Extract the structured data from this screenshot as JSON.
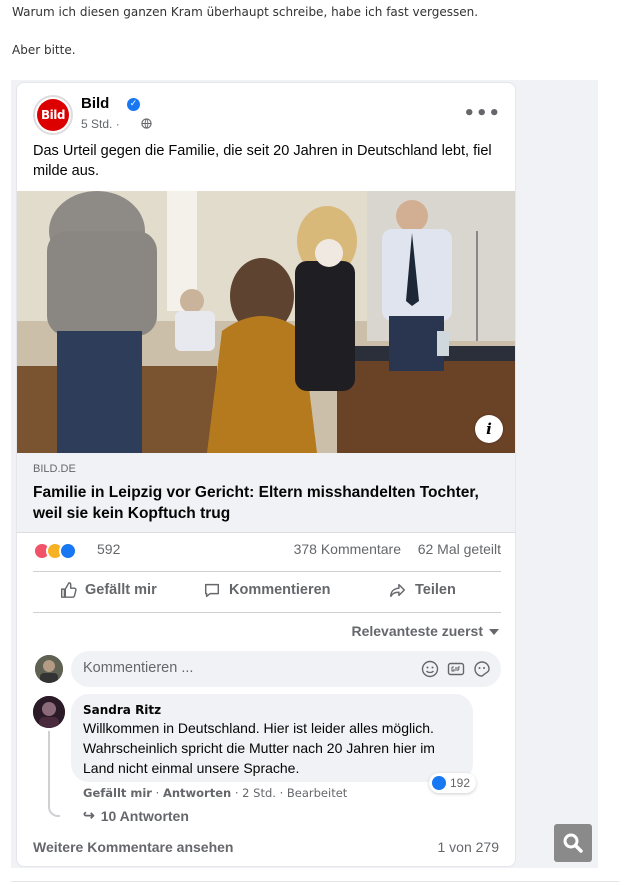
{
  "blog": {
    "line1": "Warum ich diesen ganzen Kram überhaupt schreibe, habe ich fast vergessen.",
    "line2": "Aber bitte."
  },
  "post": {
    "logo_text": "Bild",
    "page_name": "Bild",
    "time": "5 Std. ·",
    "text": "Das Urteil gegen die Familie, die seit 20 Jahren in Deutschland lebt, fiel milde aus.",
    "info_icon": "i",
    "link": {
      "domain": "BILD.DE",
      "title": "Familie in Leipzig vor Gericht: Eltern misshandelten Tochter, weil sie kein Kopftuch trug"
    },
    "stats": {
      "reactions_count": "592",
      "comments": "378 Kommentare",
      "shares": "62 Mal geteilt"
    },
    "actions": {
      "like": "Gefällt mir",
      "comment": "Kommentieren",
      "share": "Teilen"
    },
    "sort_label": "Relevanteste zuerst"
  },
  "comment_box": {
    "placeholder": "Kommentieren ..."
  },
  "comment": {
    "author": "Sandra Ritz",
    "text": "Willkommen in Deutschland. Hier ist leider alles möglich. Wahrscheinlich spricht die Mutter nach 20 Jahren hier im Land nicht einmal unsere Sprache.",
    "likes": "192",
    "like_link": "Gefällt mir",
    "reply_link": "Antworten",
    "time": "· 2 Std. · Bearbeitet",
    "sep": "·",
    "replies": "10 Antworten"
  },
  "footer": {
    "more_comments": "Weitere Kommentare ansehen",
    "page_count": "1 von 279"
  },
  "colors": {
    "fb_blue": "#1877f2",
    "bild_red": "#dd0000",
    "muted": "#65676b"
  }
}
